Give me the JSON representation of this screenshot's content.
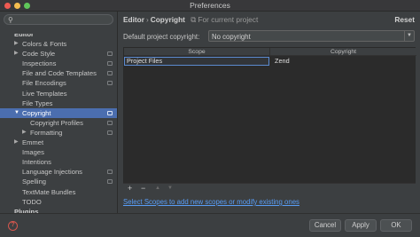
{
  "window": {
    "title": "Preferences"
  },
  "search": {
    "placeholder": "",
    "value": ""
  },
  "sidebar": {
    "items": [
      {
        "label": "Editor",
        "header": true
      },
      {
        "label": "Colors & Fonts",
        "arrow": "right"
      },
      {
        "label": "Code Style",
        "arrow": "right",
        "project": true
      },
      {
        "label": "Inspections",
        "project": true
      },
      {
        "label": "File and Code Templates",
        "project": true
      },
      {
        "label": "File Encodings",
        "project": true
      },
      {
        "label": "Live Templates"
      },
      {
        "label": "File Types"
      },
      {
        "label": "Copyright",
        "arrow": "down",
        "project": true,
        "selected": true
      },
      {
        "label": "Copyright Profiles",
        "indent": 2,
        "project": true
      },
      {
        "label": "Formatting",
        "indent": 2,
        "arrow": "right",
        "project": true
      },
      {
        "label": "Emmet",
        "arrow": "right"
      },
      {
        "label": "Images"
      },
      {
        "label": "Intentions"
      },
      {
        "label": "Language Injections",
        "project": true
      },
      {
        "label": "Spelling",
        "project": true
      },
      {
        "label": "TextMate Bundles"
      },
      {
        "label": "TODO"
      },
      {
        "label": "Plugins",
        "header": true
      }
    ]
  },
  "breadcrumb": {
    "section": "Editor",
    "separator": "›",
    "page": "Copyright",
    "scope_note": "For current project"
  },
  "reset_label": "Reset",
  "default_copyright": {
    "label": "Default project copyright:",
    "value": "No copyright"
  },
  "table": {
    "columns": [
      "Scope",
      "Copyright"
    ],
    "rows": [
      {
        "scope": "Project Files",
        "copyright": "Zend"
      }
    ]
  },
  "toolbar": {
    "add": "+",
    "remove": "−",
    "up": "▲",
    "down": "▼"
  },
  "link_text": "Select Scopes to add new scopes or modify existing ones",
  "footer": {
    "help": "?",
    "cancel": "Cancel",
    "apply": "Apply",
    "ok": "OK"
  },
  "colors": {
    "selection": "#4b6eaf",
    "link": "#589df6",
    "background": "#3c3f41"
  }
}
